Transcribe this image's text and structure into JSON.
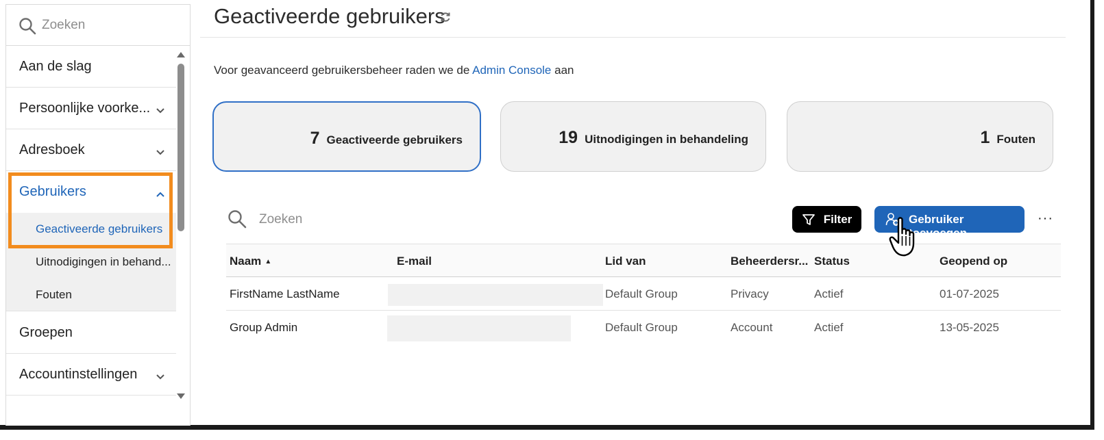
{
  "sidebar": {
    "search_placeholder": "Zoeken",
    "items": [
      {
        "label": "Aan de slag"
      },
      {
        "label": "Persoonlijke voorke..."
      },
      {
        "label": "Adresboek"
      },
      {
        "label": "Gebruikers"
      },
      {
        "label": "Groepen"
      },
      {
        "label": "Accountinstellingen"
      }
    ],
    "subitems": [
      {
        "label": "Geactiveerde gebruikers"
      },
      {
        "label": "Uitnodigingen in behand..."
      },
      {
        "label": "Fouten"
      }
    ]
  },
  "header": {
    "title": "Geactiveerde gebruikers"
  },
  "intro": {
    "before": "Voor geavanceerd gebruikersbeheer raden we de ",
    "link": "Admin Console",
    "after": " aan"
  },
  "cards": [
    {
      "count": "7",
      "label": "Geactiveerde gebruikers"
    },
    {
      "count": "19",
      "label": "Uitnodigingen in behandeling"
    },
    {
      "count": "1",
      "label": "Fouten"
    }
  ],
  "toolbar": {
    "search_placeholder": "Zoeken",
    "filter_label": "Filter",
    "add_user_label": "Gebruiker toevoegen",
    "more_label": "···"
  },
  "table": {
    "columns": [
      "Naam",
      "E-mail",
      "Lid van",
      "Beheerdersr...",
      "Status",
      "Geopend op"
    ],
    "rows": [
      {
        "name": "FirstName LastName",
        "email": "",
        "group": "Default Group",
        "role": "Privacy",
        "status": "Actief",
        "opened": "01-07-2025"
      },
      {
        "name": "Group Admin",
        "email": "",
        "group": "Default Group",
        "role": "Account",
        "status": "Actief",
        "opened": "13-05-2025"
      }
    ]
  },
  "colors": {
    "accent": "#1f65b8",
    "highlight": "#f28c1e",
    "card_bg": "#f1f1f1"
  }
}
